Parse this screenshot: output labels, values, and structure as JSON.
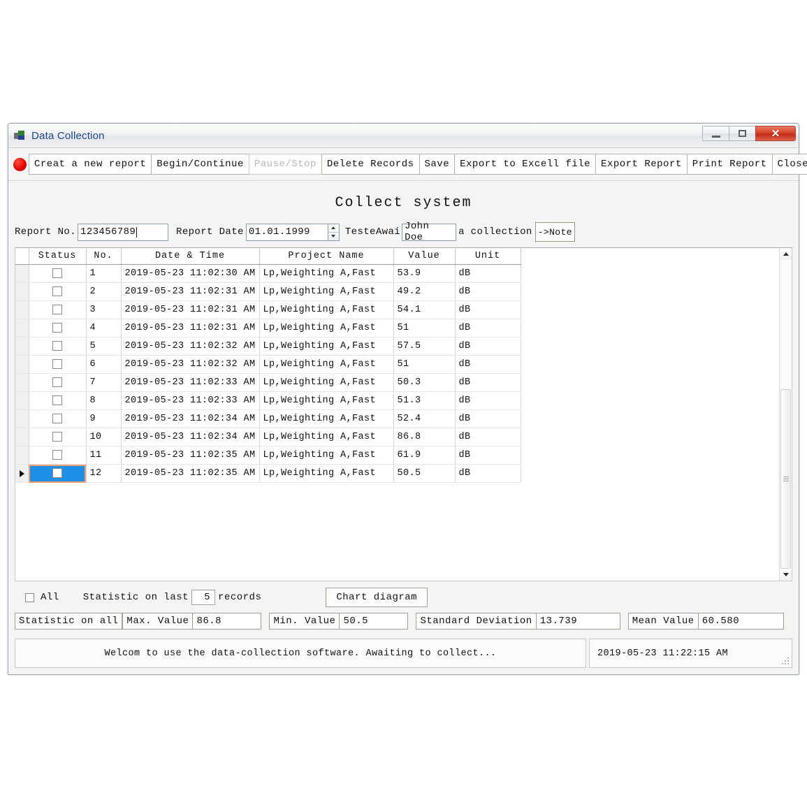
{
  "window": {
    "title": "Data Collection",
    "icon": "app-icon",
    "minimize_label": "–",
    "maximize_label": "□",
    "close_label": "✕"
  },
  "toolbar": {
    "indicator": "record-dot",
    "buttons": [
      {
        "label": "Creat a new report",
        "disabled": false
      },
      {
        "label": "Begin/Continue",
        "disabled": false
      },
      {
        "label": "Pause/Stop",
        "disabled": true
      },
      {
        "label": "Delete Records",
        "disabled": false
      },
      {
        "label": "Save",
        "disabled": false
      },
      {
        "label": "Export to Excell file",
        "disabled": false
      },
      {
        "label": "Export Report",
        "disabled": false
      },
      {
        "label": "Print Report",
        "disabled": false
      },
      {
        "label": "Close Window",
        "disabled": false
      }
    ]
  },
  "page": {
    "heading": "Collect system"
  },
  "form": {
    "report_no_label": "Report No.",
    "report_no_value": "123456789",
    "report_date_label": "Report Date",
    "report_date_value": "01.01.1999",
    "tester_label": "TesteAwai",
    "tester_value": "John Doe",
    "collection_label": "a collection",
    "note_button": "->Note"
  },
  "grid": {
    "columns": [
      "Status",
      "No.",
      "Date & Time",
      "Project Name",
      "Value",
      "Unit"
    ],
    "rows": [
      {
        "no": "1",
        "datetime": "2019-05-23 11:02:30 AM",
        "project": "Lp,Weighting A,Fast",
        "value": "53.9",
        "unit": "dB",
        "selected": false,
        "checked": false
      },
      {
        "no": "2",
        "datetime": "2019-05-23 11:02:31 AM",
        "project": "Lp,Weighting A,Fast",
        "value": "49.2",
        "unit": "dB",
        "selected": false,
        "checked": false
      },
      {
        "no": "3",
        "datetime": "2019-05-23 11:02:31 AM",
        "project": "Lp,Weighting A,Fast",
        "value": "54.1",
        "unit": "dB",
        "selected": false,
        "checked": false
      },
      {
        "no": "4",
        "datetime": "2019-05-23 11:02:31 AM",
        "project": "Lp,Weighting A,Fast",
        "value": "51",
        "unit": "dB",
        "selected": false,
        "checked": false
      },
      {
        "no": "5",
        "datetime": "2019-05-23 11:02:32 AM",
        "project": "Lp,Weighting A,Fast",
        "value": "57.5",
        "unit": "dB",
        "selected": false,
        "checked": false
      },
      {
        "no": "6",
        "datetime": "2019-05-23 11:02:32 AM",
        "project": "Lp,Weighting A,Fast",
        "value": "51",
        "unit": "dB",
        "selected": false,
        "checked": false
      },
      {
        "no": "7",
        "datetime": "2019-05-23 11:02:33 AM",
        "project": "Lp,Weighting A,Fast",
        "value": "50.3",
        "unit": "dB",
        "selected": false,
        "checked": false
      },
      {
        "no": "8",
        "datetime": "2019-05-23 11:02:33 AM",
        "project": "Lp,Weighting A,Fast",
        "value": "51.3",
        "unit": "dB",
        "selected": false,
        "checked": false
      },
      {
        "no": "9",
        "datetime": "2019-05-23 11:02:34 AM",
        "project": "Lp,Weighting A,Fast",
        "value": "52.4",
        "unit": "dB",
        "selected": false,
        "checked": false
      },
      {
        "no": "10",
        "datetime": "2019-05-23 11:02:34 AM",
        "project": "Lp,Weighting A,Fast",
        "value": "86.8",
        "unit": "dB",
        "selected": false,
        "checked": false
      },
      {
        "no": "11",
        "datetime": "2019-05-23 11:02:35 AM",
        "project": "Lp,Weighting A,Fast",
        "value": "61.9",
        "unit": "dB",
        "selected": false,
        "checked": false
      },
      {
        "no": "12",
        "datetime": "2019-05-23 11:02:35 AM",
        "project": "Lp,Weighting A,Fast",
        "value": "50.5",
        "unit": "dB",
        "selected": true,
        "checked": false
      }
    ],
    "selection_highlight_color": "#1e90e8",
    "selection_border_color": "#f0a070"
  },
  "statistics_controls": {
    "all_label": "All",
    "all_checked": false,
    "last_prefix": "Statistic on last",
    "last_count": "5",
    "last_suffix": "records",
    "chart_button": "Chart diagram"
  },
  "statistics": {
    "scope_label": "Statistic on all",
    "max_label": "Max. Value",
    "max_value": "86.8",
    "min_label": "Min. Value",
    "min_value": "50.5",
    "std_label": "Standard Deviation",
    "std_value": "13.739",
    "mean_label": "Mean Value",
    "mean_value": "60.580"
  },
  "statusbar": {
    "message": "Welcom to use the data-collection software. Awaiting to collect...",
    "timestamp": "2019-05-23 11:22:15 AM"
  }
}
